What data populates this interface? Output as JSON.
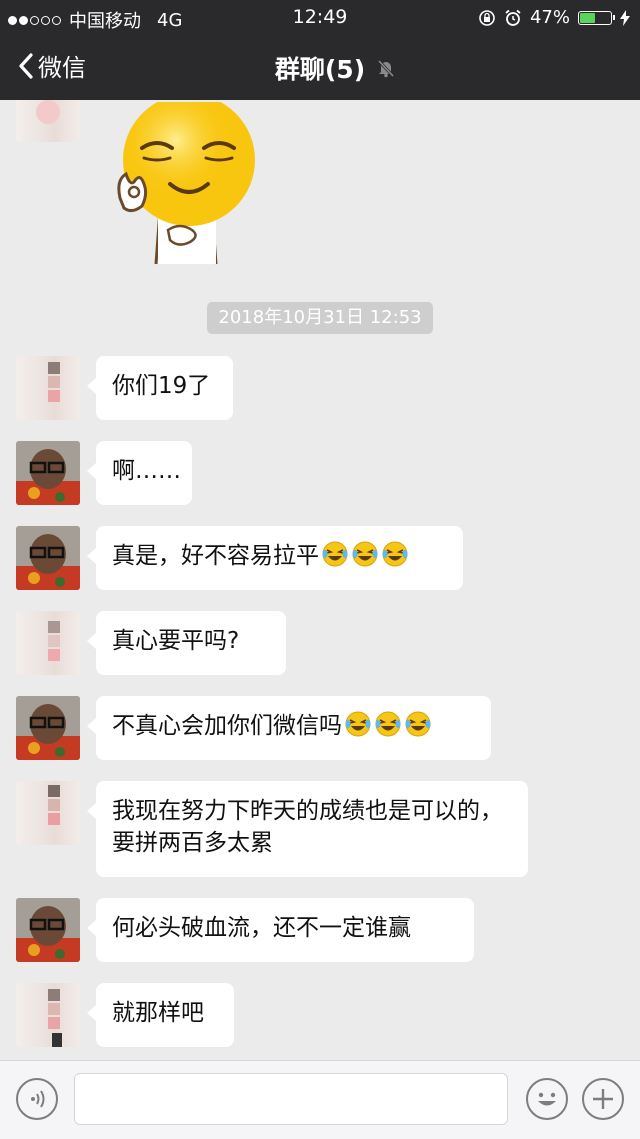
{
  "status_bar": {
    "carrier": "中国移动",
    "network": "4G",
    "time": "12:49",
    "battery": "47%",
    "battery_level": 0.47
  },
  "nav": {
    "back_label": "微信",
    "title": "群聊(5)"
  },
  "chat": {
    "timestamp": "2018年10月31日 12:53",
    "messages": [
      {
        "text": "你们19了"
      },
      {
        "text": "啊……"
      },
      {
        "text": "真是，好不容易拉平",
        "emoji": "laughing-crying-emoji"
      },
      {
        "text": "真心要平吗?"
      },
      {
        "text": "不真心会加你们微信吗",
        "emoji": "laughing-crying-emoji"
      },
      {
        "text": "我现在努力下昨天的成绩也是可以的，要拼两百多太累"
      },
      {
        "text": "何必头破血流，还不一定谁赢"
      },
      {
        "text": "就那样吧"
      }
    ]
  },
  "colors": {
    "header_bg": "#2a2a2d",
    "chat_bg": "#ebebeb",
    "bubble_bg": "#ffffff",
    "timestamp_bg": "#cecece"
  }
}
